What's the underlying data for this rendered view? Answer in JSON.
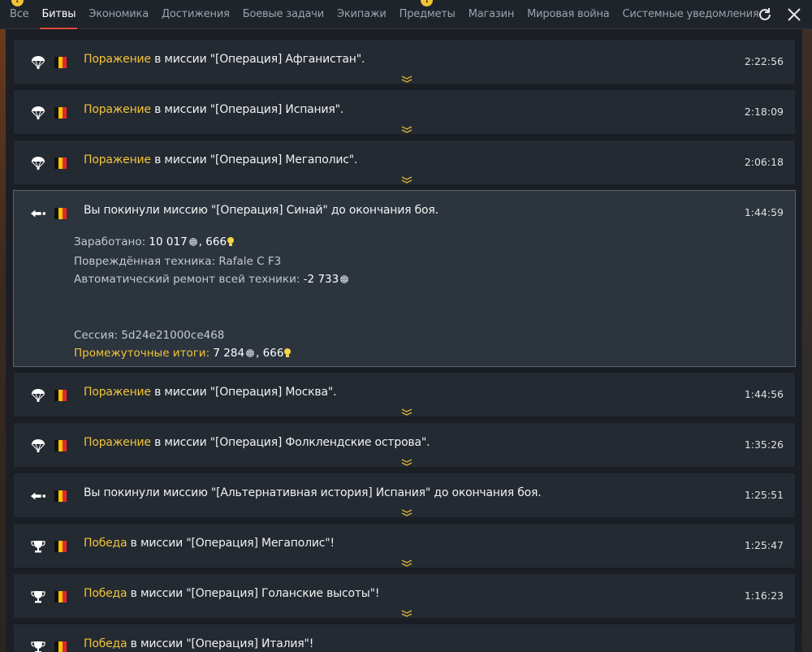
{
  "tabs": [
    {
      "label": "Все",
      "badge": "!",
      "active": false
    },
    {
      "label": "Битвы",
      "badge": "",
      "active": true
    },
    {
      "label": "Экономика",
      "badge": "",
      "active": false
    },
    {
      "label": "Достижения",
      "badge": "",
      "active": false
    },
    {
      "label": "Боевые задачи",
      "badge": "",
      "active": false
    },
    {
      "label": "Экипажи",
      "badge": "",
      "active": false
    },
    {
      "label": "Предметы",
      "badge": "!",
      "active": false
    },
    {
      "label": "Магазин",
      "badge": "",
      "active": false
    },
    {
      "label": "Мировая война",
      "badge": "",
      "active": false
    },
    {
      "label": "Системные уведомления",
      "badge": "",
      "active": false
    }
  ],
  "toolbar": {
    "refresh_icon": "refresh-icon",
    "close_icon": "close-icon"
  },
  "colors": {
    "highlight": "#f0c43a",
    "active_tab_underline": "#d94a3a",
    "badge": "#f1c232"
  },
  "messages": [
    {
      "icon": "parachute-icon",
      "status": "Поражение",
      "text": " в миссии \"[Операция] Афганистан\".",
      "time": "2:22:56"
    },
    {
      "icon": "parachute-icon",
      "status": "Поражение",
      "text": " в миссии \"[Операция] Испания\".",
      "time": "2:18:09"
    },
    {
      "icon": "parachute-icon",
      "status": "Поражение",
      "text": " в миссии \"[Операция] Мегаполис\".",
      "time": "2:06:18"
    },
    {
      "icon": "leave-icon",
      "status": "",
      "text": "Вы покинули миссию \"[Операция] Синай\" до окончания боя.",
      "time": "1:44:59",
      "expanded": true,
      "details": {
        "earned_label": "Заработано: ",
        "earned_silver": "10 017",
        "earned_sep": ", ",
        "earned_rp": "666",
        "damaged_label": "Повреждённая техника: ",
        "damaged_value": "Rafale C F3",
        "repair_label": "Автоматический ремонт всей техники: ",
        "repair_value": "-2 733",
        "session_label": "Сессия: ",
        "session_value": "5d24e21000ce468",
        "total_label": "Промежуточные итоги: ",
        "total_silver": "7 284",
        "total_sep": ", ",
        "total_rp": "666"
      }
    },
    {
      "icon": "parachute-icon",
      "status": "Поражение",
      "text": " в миссии \"[Операция] Москва\".",
      "time": "1:44:56"
    },
    {
      "icon": "parachute-icon",
      "status": "Поражение",
      "text": " в миссии \"[Операция] Фолклендские острова\".",
      "time": "1:35:26"
    },
    {
      "icon": "leave-icon",
      "status": "",
      "text": "Вы покинули миссию \"[Альтернативная история] Испания\" до окончания боя.",
      "time": "1:25:51"
    },
    {
      "icon": "trophy-icon",
      "status": "Победа",
      "text": " в миссии \"[Операция] Мегаполис\"!",
      "time": "1:25:47"
    },
    {
      "icon": "trophy-icon",
      "status": "Победа",
      "text": " в миссии \"[Операция] Голанские высоты\"!",
      "time": "1:16:23"
    },
    {
      "icon": "trophy-icon",
      "status": "Победа",
      "text": " в миссии \"[Операция] Италия\"!",
      "time": ""
    }
  ]
}
